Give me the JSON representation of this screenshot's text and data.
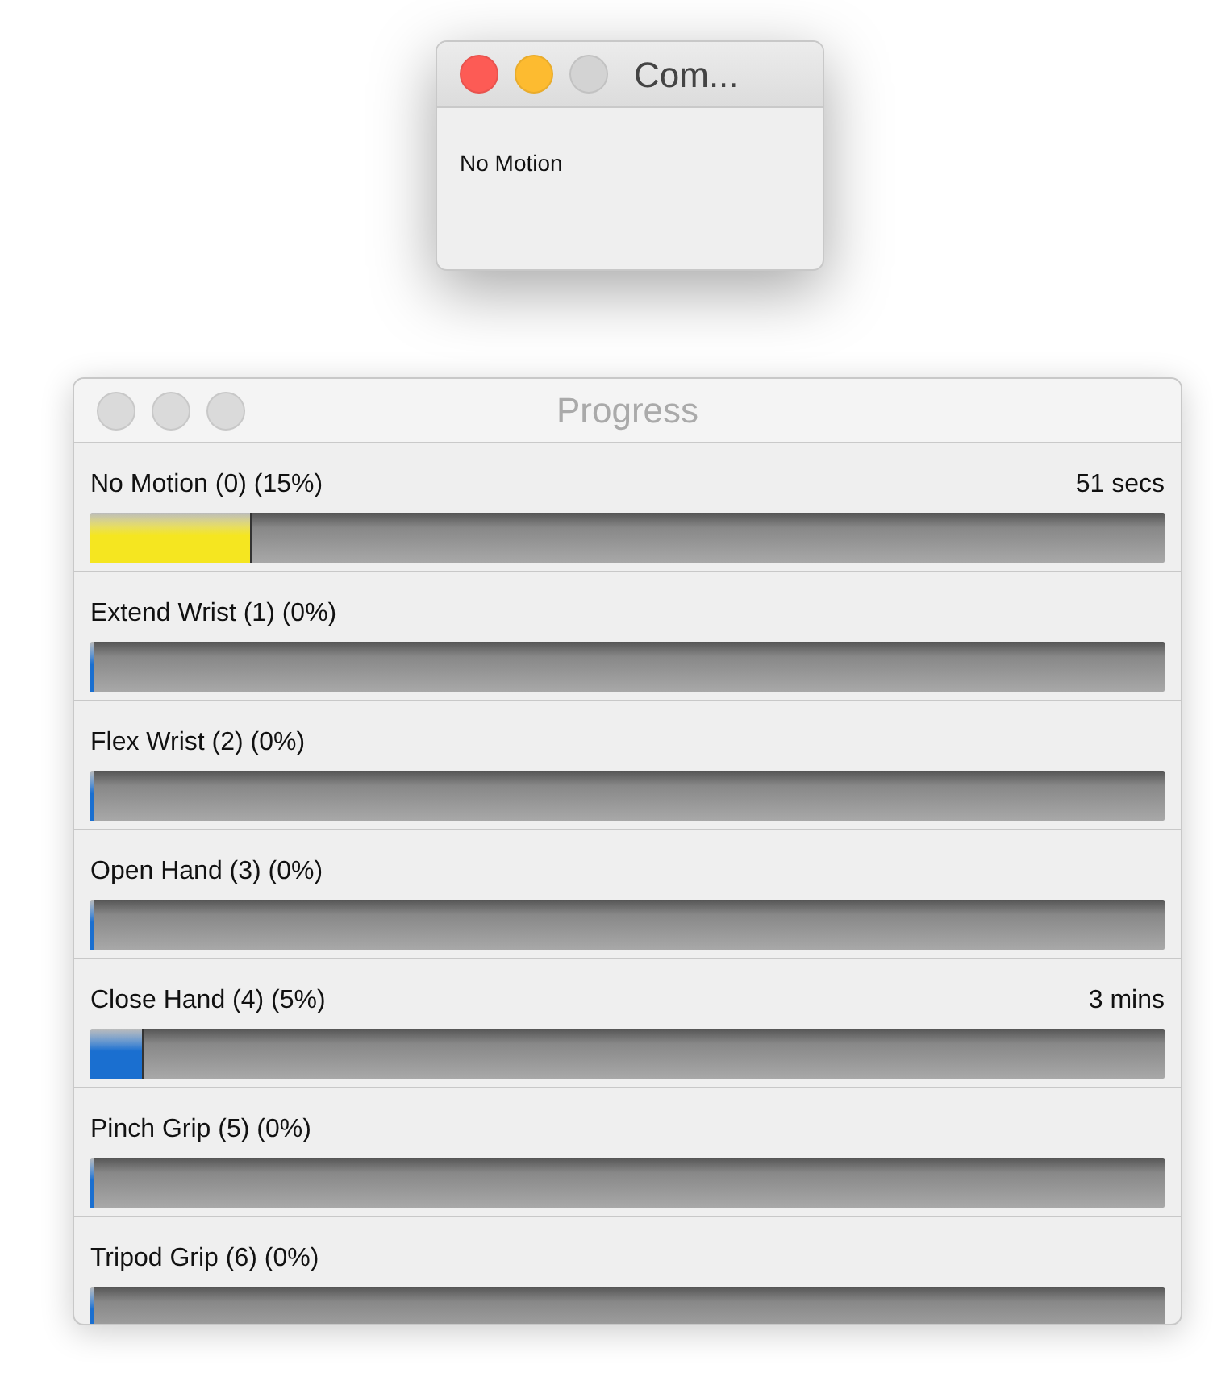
{
  "windows": [
    {
      "title": "Com...",
      "active": true,
      "message": "No Motion"
    },
    {
      "title": "Progress",
      "active": false
    }
  ],
  "progress_rows": [
    {
      "label": "No Motion (0) (15%)",
      "time": "51 secs",
      "level": 0.15,
      "color": "#f5e620"
    },
    {
      "label": "Extend Wrist (1) (0%)",
      "level": 0,
      "color": "#1a6fd0"
    },
    {
      "label": "Flex Wrist (2) (0%)",
      "level": 0,
      "color": "#1a6fd0"
    },
    {
      "label": "Open Hand (3) (0%)",
      "level": 0,
      "color": "#1a6fd0"
    },
    {
      "label": "Close Hand (4) (5%)",
      "time": "3 mins",
      "level": 0.05,
      "color": "#1a6fd0"
    },
    {
      "label": "Pinch Grip (5) (0%)",
      "level": 0,
      "color": "#1a6fd0"
    },
    {
      "label": "Tripod Grip (6) (0%)",
      "level": 0,
      "color": "#1a6fd0"
    }
  ]
}
